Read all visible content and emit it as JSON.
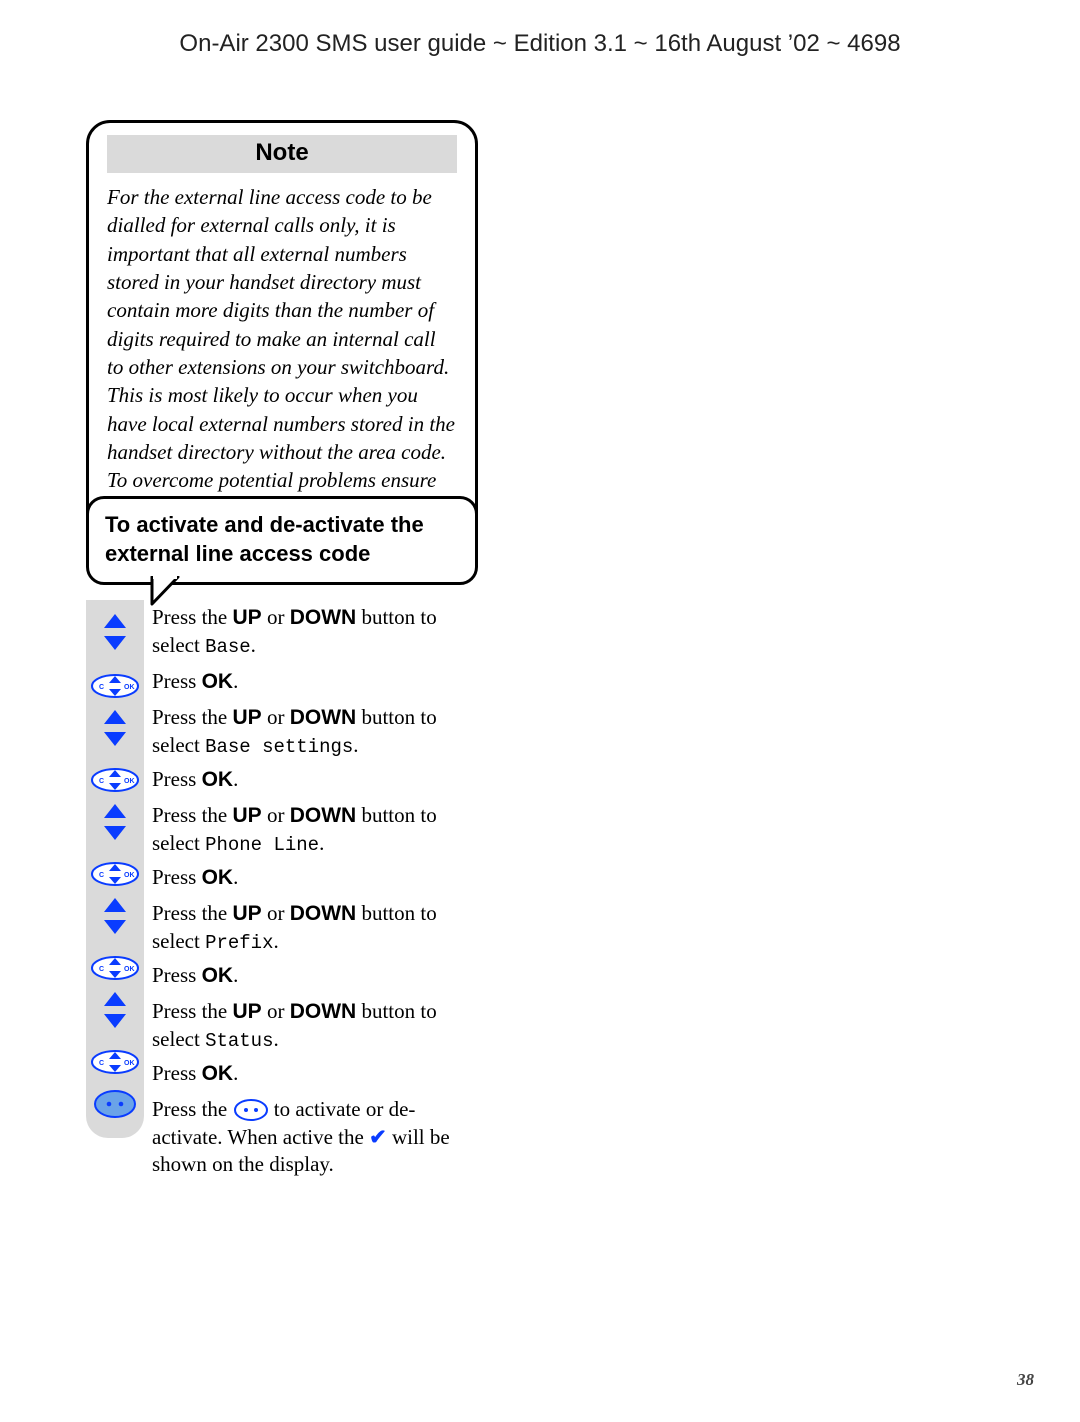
{
  "header": "On-Air 2300 SMS user guide ~ Edition 3.1 ~ 16th August ’02 ~ 4698",
  "page_number": "38",
  "note": {
    "title": "Note",
    "body": "For the external line access code to be dialled for external calls only, it is important that all external numbers stored in your handset directory must contain more digits than the number of digits required to make an internal call to other extensions on your switchboard. This is most likely to occur when you have local external numbers stored in the handset directory without the area code. To overcome potential problems ensure that all numbers are stored complete with area code."
  },
  "proc_title": "To activate and de-activate the external line access code",
  "labels": {
    "press_the": "Press the ",
    "up": "UP",
    "or": " or ",
    "down": "DOWN",
    "button_to_select": " button to select ",
    "press": "Press ",
    "ok": "OK",
    "period": ".",
    "menu_base": "Base",
    "menu_base_settings": "Base settings",
    "menu_phone_line": "Phone Line",
    "menu_prefix": "Prefix",
    "menu_status": "Status",
    "final_pre": "Press the ",
    "final_mid": " to activate or de-activate. When active the ",
    "final_post": " will be shown on the display.",
    "check": "✔"
  }
}
